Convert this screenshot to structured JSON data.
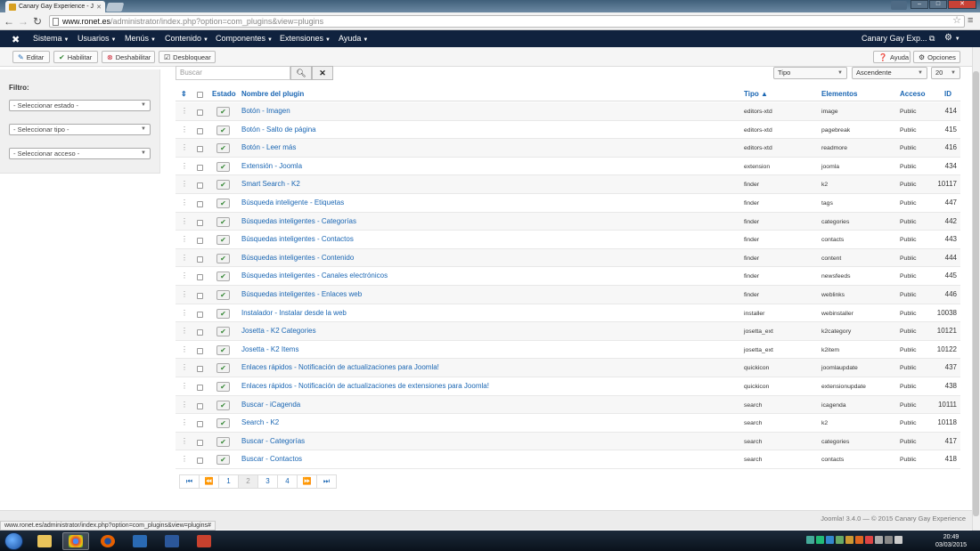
{
  "browser": {
    "tab_title": "Canary Gay Experience - J",
    "url_domain": "www.ronet.es",
    "url_path": "/administrator/index.php?option=com_plugins&view=plugins",
    "status_url": "www.ronet.es/administrator/index.php?option=com_plugins&view=plugins#"
  },
  "navbar": {
    "items": [
      "Sistema",
      "Usuarios",
      "Menús",
      "Contenido",
      "Componentes",
      "Extensiones",
      "Ayuda"
    ],
    "site_name": "Canary Gay Exp..."
  },
  "toolbar": {
    "edit_label": "Editar",
    "enable_label": "Habilitar",
    "disable_label": "Deshabilitar",
    "unlock_label": "Desbloquear",
    "help_label": "Ayuda",
    "options_label": "Opciones"
  },
  "sidebar": {
    "filter_title": "Filtro:",
    "state_select": "- Seleccionar estado -",
    "type_select": "- Seleccionar tipo -",
    "access_select": "- Seleccionar acceso -"
  },
  "filters": {
    "search_placeholder": "Buscar",
    "type_select": "Tipo",
    "order_select": "Ascendente",
    "limit_select": "20"
  },
  "table": {
    "headers": {
      "status": "Estado",
      "name": "Nombre del plugin",
      "type": "Tipo",
      "element": "Elementos",
      "access": "Acceso",
      "id": "ID"
    },
    "rows": [
      {
        "name": "Botón - Imagen",
        "type": "editors-xtd",
        "element": "image",
        "access": "Public",
        "id": "414"
      },
      {
        "name": "Botón - Salto de página",
        "type": "editors-xtd",
        "element": "pagebreak",
        "access": "Public",
        "id": "415"
      },
      {
        "name": "Botón - Leer más",
        "type": "editors-xtd",
        "element": "readmore",
        "access": "Public",
        "id": "416"
      },
      {
        "name": "Extensión - Joomla",
        "type": "extension",
        "element": "joomla",
        "access": "Public",
        "id": "434"
      },
      {
        "name": "Smart Search - K2",
        "type": "finder",
        "element": "k2",
        "access": "Public",
        "id": "10117"
      },
      {
        "name": "Búsqueda inteligente - Etiquetas",
        "type": "finder",
        "element": "tags",
        "access": "Public",
        "id": "447"
      },
      {
        "name": "Búsquedas inteligentes - Categorías",
        "type": "finder",
        "element": "categories",
        "access": "Public",
        "id": "442"
      },
      {
        "name": "Búsquedas inteligentes - Contactos",
        "type": "finder",
        "element": "contacts",
        "access": "Public",
        "id": "443"
      },
      {
        "name": "Búsquedas inteligentes - Contenido",
        "type": "finder",
        "element": "content",
        "access": "Public",
        "id": "444"
      },
      {
        "name": "Búsquedas inteligentes - Canales electrónicos",
        "type": "finder",
        "element": "newsfeeds",
        "access": "Public",
        "id": "445"
      },
      {
        "name": "Búsquedas inteligentes - Enlaces web",
        "type": "finder",
        "element": "weblinks",
        "access": "Public",
        "id": "446"
      },
      {
        "name": "Instalador - Instalar desde la web",
        "type": "installer",
        "element": "webinstaller",
        "access": "Public",
        "id": "10038"
      },
      {
        "name": "Josetta - K2 Categories",
        "type": "josetta_ext",
        "element": "k2category",
        "access": "Public",
        "id": "10121"
      },
      {
        "name": "Josetta - K2 Items",
        "type": "josetta_ext",
        "element": "k2item",
        "access": "Public",
        "id": "10122"
      },
      {
        "name": "Enlaces rápidos - Notificación de actualizaciones para Joomla!",
        "type": "quickicon",
        "element": "joomlaupdate",
        "access": "Public",
        "id": "437"
      },
      {
        "name": "Enlaces rápidos - Notificación de actualizaciones de extensiones para Joomla!",
        "type": "quickicon",
        "element": "extensionupdate",
        "access": "Public",
        "id": "438"
      },
      {
        "name": "Buscar - iCagenda",
        "type": "search",
        "element": "icagenda",
        "access": "Public",
        "id": "10111"
      },
      {
        "name": "Search - K2",
        "type": "search",
        "element": "k2",
        "access": "Public",
        "id": "10118"
      },
      {
        "name": "Buscar - Categorías",
        "type": "search",
        "element": "categories",
        "access": "Public",
        "id": "417"
      },
      {
        "name": "Buscar - Contactos",
        "type": "search",
        "element": "contacts",
        "access": "Public",
        "id": "418"
      }
    ]
  },
  "pagination": {
    "pages": [
      "1",
      "2",
      "3",
      "4"
    ],
    "active_page": "2"
  },
  "footer": {
    "text": "Joomla! 3.4.0 — © 2015 Canary Gay Experience"
  },
  "clock": {
    "time": "20:49",
    "date": "03/03/2015"
  },
  "icons": [
    "joomla-icon",
    "search-icon",
    "clear-icon",
    "gear-icon",
    "star-icon"
  ],
  "colors": {
    "navbar": "#10223e",
    "link": "#1a66b3",
    "status_green": "#3a8a3a"
  }
}
